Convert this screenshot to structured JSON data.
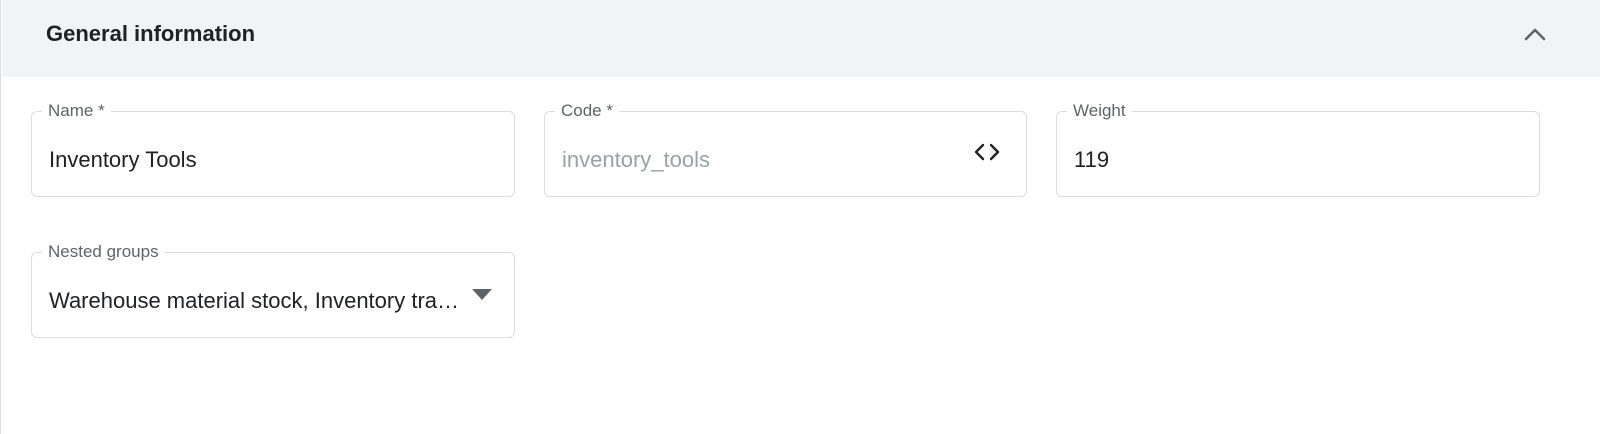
{
  "section": {
    "title": "General information",
    "collapse_icon": "chevron-up-icon"
  },
  "fields": {
    "name": {
      "label": "Name *",
      "value": "Inventory Tools"
    },
    "code": {
      "label": "Code *",
      "value": "inventory_tools",
      "icon": "code-icon"
    },
    "weight": {
      "label": "Weight",
      "value": "119"
    },
    "nested_groups": {
      "label": "Nested groups",
      "value": "Warehouse material stock, Inventory tra…",
      "icon": "dropdown-arrow-icon"
    }
  },
  "colors": {
    "header_bg": "#f1f3f4",
    "border": "#dadce0",
    "label": "#5f6368",
    "text": "#202124",
    "disabled_text": "#9aa0a6"
  }
}
